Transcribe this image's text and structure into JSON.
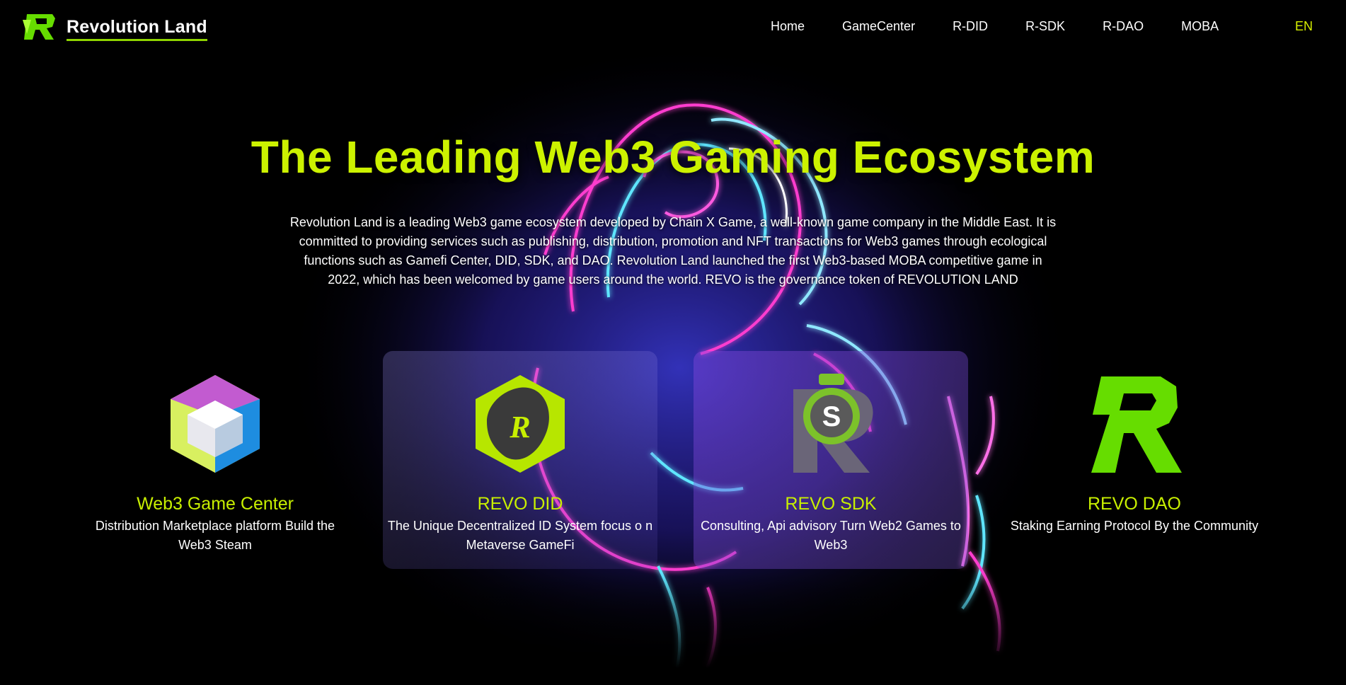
{
  "header": {
    "brand_name": "Revolution Land",
    "nav": [
      "Home",
      "GameCenter",
      "R-DID",
      "R-SDK",
      "R-DAO",
      "MOBA"
    ],
    "language": "EN"
  },
  "hero": {
    "title": "The Leading Web3 Gaming Ecosystem",
    "description": "Revolution Land is a leading Web3 game ecosystem developed by Chain X Game, a well-known game company in the Middle East. It is committed to providing services such as publishing, distribution, promotion and NFT transactions for Web3 games through ecological functions such as Gamefi Center, DID, SDK, and DAO. Revolution Land launched the first Web3-based MOBA competitive game in 2022, which has been welcomed by game users around the world. REVO is the governance token of REVOLUTION LAND"
  },
  "features": [
    {
      "title": "Web3 Game Center",
      "desc": "Distribution Marketplace platform Build the Web3 Steam",
      "icon": "cube-hexagon-icon"
    },
    {
      "title": "REVO DID",
      "desc": "The Unique Decentralized ID System focus o n Metaverse GameFi",
      "icon": "revo-did-icon"
    },
    {
      "title": "REVO SDK",
      "desc": "Consulting, Api advisory Turn Web2 Games to Web3",
      "icon": "revo-sdk-icon"
    },
    {
      "title": "REVO DAO",
      "desc": "Staking Earning Protocol By the Community",
      "icon": "revo-dao-icon"
    }
  ],
  "colors": {
    "accent": "#ccf200",
    "brand_green": "#66dd00",
    "background": "#000000",
    "neon_pink": "#ff3ccf",
    "neon_cyan": "#5fe6ff"
  }
}
